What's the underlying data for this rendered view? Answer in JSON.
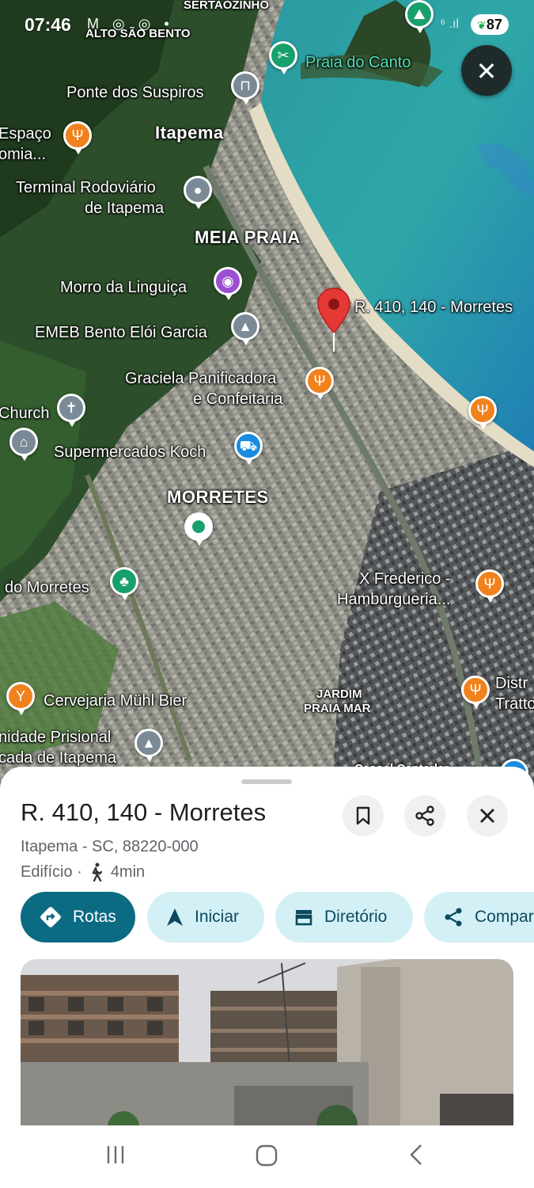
{
  "status_bar": {
    "time": "07:46",
    "notification_icons": "M ◎ ◎ •",
    "signal": "⁶ .ıl",
    "battery": "87"
  },
  "map": {
    "labels": {
      "sertaozinho": "SERTAOZINHO",
      "alto_sao_bento": "ALTO SÃO BENTO",
      "praia_do_canto": "Praia do Canto",
      "ponte_dos_suspiros": "Ponte dos Suspiros",
      "espaco_1": "Espaço",
      "espaco_2": "omia...",
      "itapema": "Itapema",
      "terminal_1": "Terminal Rodoviário",
      "terminal_2": "de Itapema",
      "meia_praia": "MEIA PRAIA",
      "morro_linguica": "Morro da Linguiça",
      "address_pin": "R. 410, 140 - Morretes",
      "emeb": "EMEB Bento Elói Garcia",
      "graciela_1": "Graciela Panificadora",
      "graciela_2": "e Confeitaria",
      "church": "Church",
      "supermercados": "Supermercados Koch",
      "morretes": "MORRETES",
      "do_morretes": "do Morretes",
      "x_frederico_1": "X Frederico -",
      "x_frederico_2": "Hamburgueria...",
      "jardim_1": "JARDIM",
      "jardim_2": "PRAIA MAR",
      "cervejaria": "Cervejaria Mühl Bier",
      "distr_1": "Distr",
      "distr_2": "Tratto",
      "prisional_1": "nidade Prisional",
      "prisional_2": "cada de Itapema",
      "bottom_cut": "Cassol Centerlar"
    },
    "close_icon": "close-icon"
  },
  "place": {
    "title": "R. 410, 140 - Morretes",
    "address": "Itapema - SC, 88220-000",
    "type": "Edifício ·",
    "walk_time": "4min"
  },
  "actions": {
    "rotas": "Rotas",
    "iniciar": "Iniciar",
    "diretorio": "Diretório",
    "compartilhar": "Compar"
  },
  "colors": {
    "primary": "#0b6b83",
    "chip_bg": "#d4f0f7",
    "pin_red": "#e53935"
  }
}
